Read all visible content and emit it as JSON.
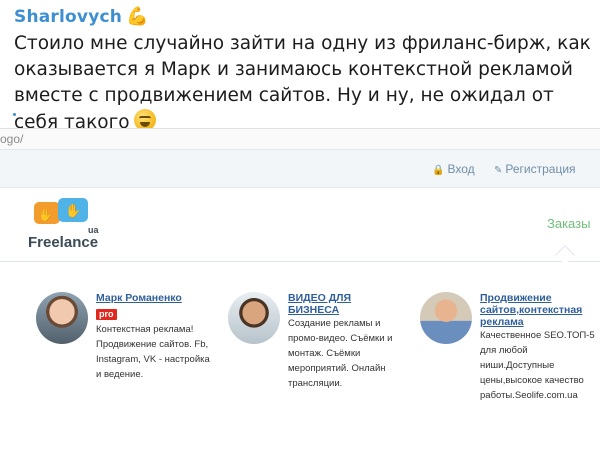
{
  "post": {
    "author": "Sharlovych",
    "author_emoji": "💪",
    "text": "Стоило мне случайно зайти на одну из фриланс-бирж, как оказывается я Марк и занимаюсь контекстной рекламой вместе с продвижением сайтов. Ну и ну, не ожидал от себя такого",
    "text_emoji": "laughing-face"
  },
  "site": {
    "url": "ogo/",
    "topbar": {
      "login_label": "Вход",
      "register_label": "Регистрация",
      "link_color": "#6f8ea8"
    },
    "logo": {
      "brand": "Freelance",
      "region": "ua"
    },
    "nav": {
      "orders_label": "Заказы",
      "orders_color": "#6fbf7a"
    },
    "freelancers": [
      {
        "name": "Марк Романенко",
        "badge": "pro",
        "description": "Контекстная реклама! Продвижение сайтов. Fb, Instagram, VK - настройка и ведение."
      },
      {
        "name": "ВИДЕО ДЛЯ БИЗНЕСА",
        "badge": "",
        "description": "Создание рекламы и промо-видео. Съёмки и монтаж. Съёмки мероприятий. Онлайн трансляции."
      },
      {
        "name": "Продвижение сайтов,контекстная реклама",
        "badge": "",
        "description": "Качественное SEO.ТОП-5 для любой ниши.Доступные цены,высокое качество работы.Seolife.com.ua"
      }
    ],
    "accent_colors": {
      "link": "#2f5f9a",
      "pro_badge": "#e0281e"
    }
  }
}
